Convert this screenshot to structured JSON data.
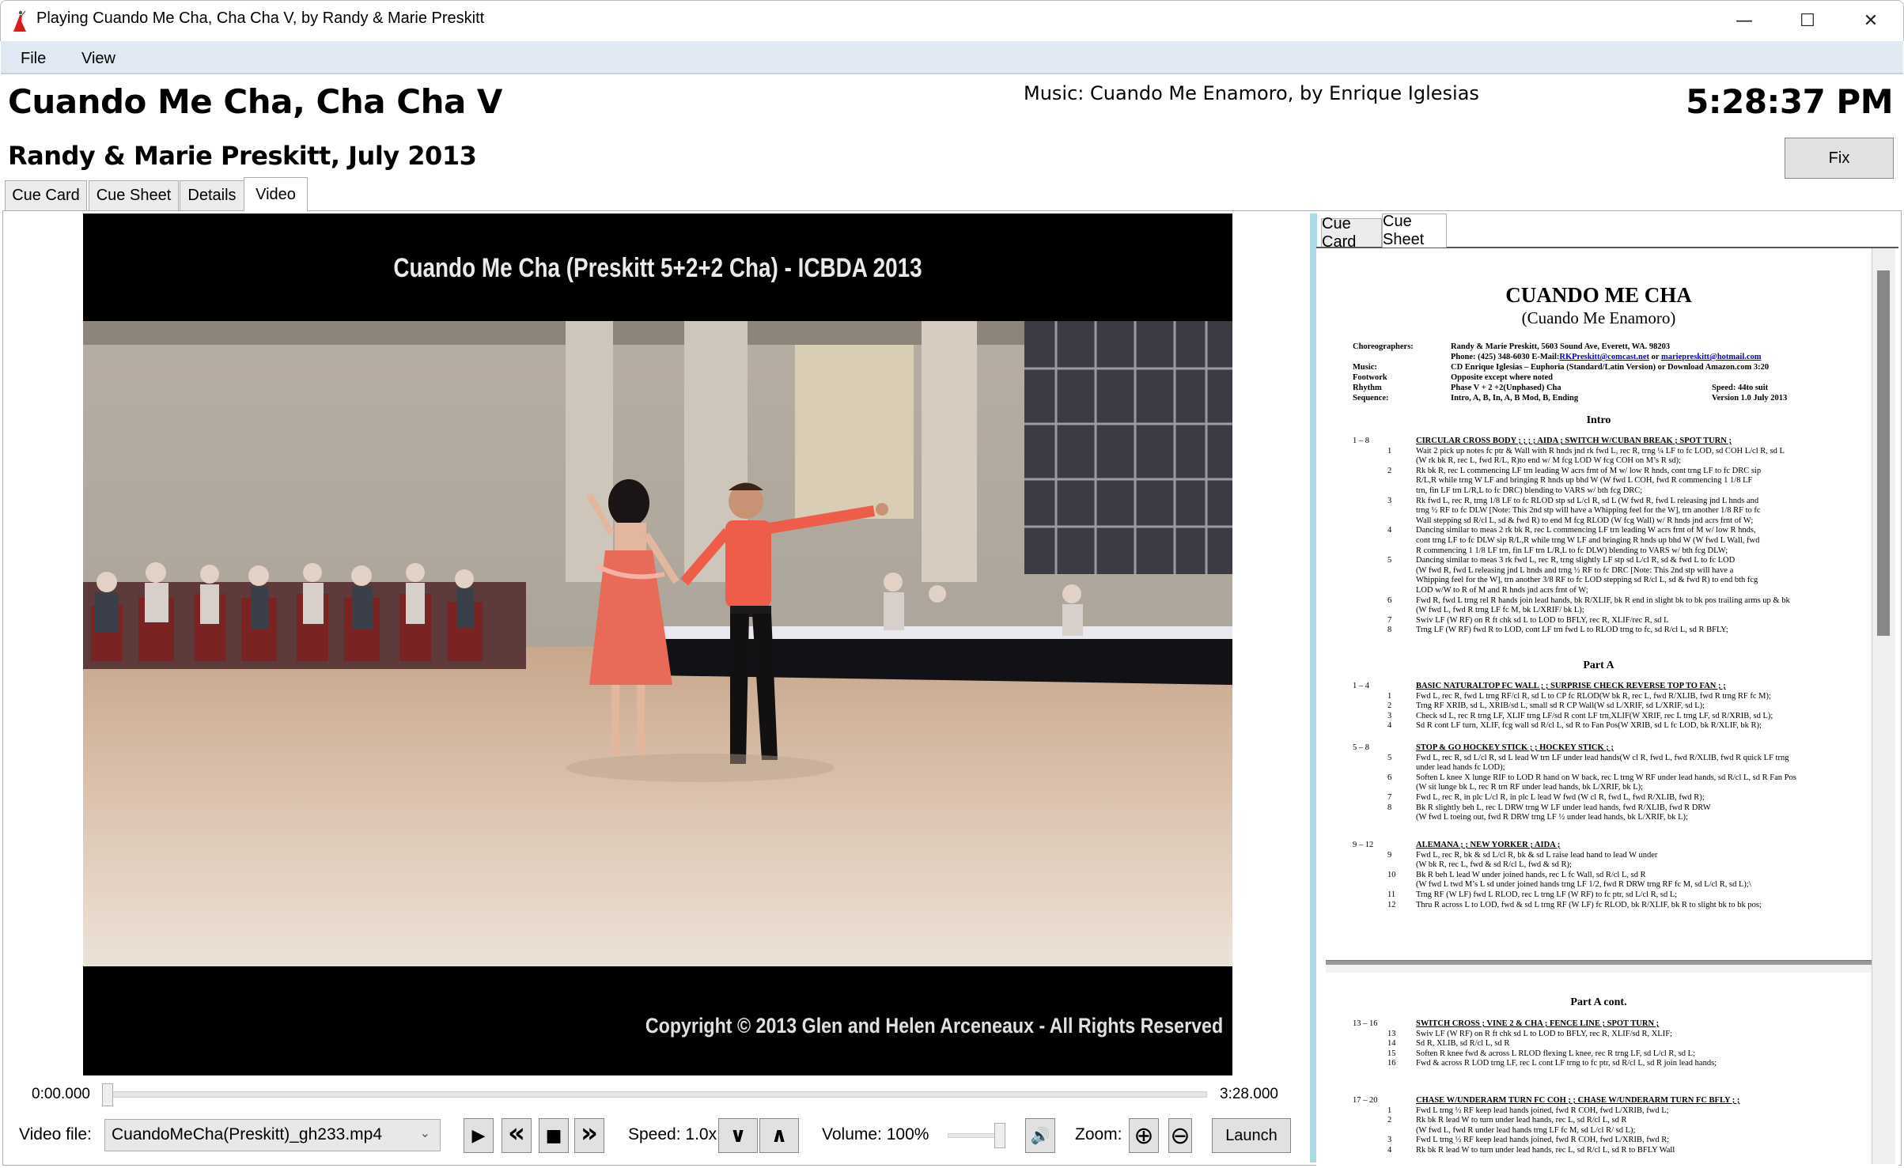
{
  "window": {
    "title": "Playing Cuando Me Cha, Cha Cha V, by Randy & Marie Preskitt",
    "minimize_glyph": "—",
    "maximize_glyph": "☐",
    "close_glyph": "✕"
  },
  "menu": {
    "items": [
      {
        "label": "File"
      },
      {
        "label": "View"
      }
    ]
  },
  "header": {
    "title": "Cuando Me Cha, Cha Cha V",
    "subtitle": "Randy & Marie Preskitt, July 2013",
    "music": "Music: Cuando Me Enamoro, by Enrique Iglesias",
    "clock": "5:28:37 PM",
    "fix_label": "Fix"
  },
  "main_tabs": [
    {
      "label": "Cue Card",
      "active": false
    },
    {
      "label": "Cue Sheet",
      "active": false
    },
    {
      "label": "Details",
      "active": false
    },
    {
      "label": "Video",
      "active": true
    }
  ],
  "video": {
    "caption_top": "Cuando Me Cha (Preskitt 5+2+2 Cha) - ICBDA 2013",
    "caption_bottom": "Copyright © 2013 Glen and Helen Arceneaux - All Rights Reserved",
    "time_current": "0:00.000",
    "time_total": "3:28.000",
    "progress_fraction": 0.0
  },
  "controls": {
    "video_file_label": "Video file:",
    "video_file_value": "CuandoMeCha(Preskitt)_gh233.mp4",
    "play_glyph": "▶",
    "rewind_glyph": "«",
    "stop_glyph": "■",
    "forward_glyph": "»",
    "speed_label": "Speed: 1.0x",
    "speed_down_glyph": "∨",
    "speed_up_glyph": "∧",
    "volume_label": "Volume: 100%",
    "volume_fraction": 1.0,
    "mute_glyph": "🔊",
    "zoom_label": "Zoom:",
    "zoom_in_glyph": "⊕",
    "zoom_out_glyph": "⊖",
    "launch_label": "Launch"
  },
  "right_tabs": [
    {
      "label": "Cue Card",
      "active": false
    },
    {
      "label": "Cue Sheet",
      "active": true
    }
  ],
  "cue_sheet": {
    "title": "CUANDO ME CHA",
    "subtitle": "(Cuando Me Enamoro)",
    "info": {
      "choreographers_key": "Choreographers:",
      "choreographers_val": "Randy & Marie Preskitt, 5603 Sound Ave, Everett, WA.  98203",
      "phone": "Phone:   (425) 348-6030   E-Mail: ",
      "email1": "RKPreskitt@comcast.net",
      "or": " or ",
      "email2": "mariepreskitt@hotmail.com",
      "music_key": "Music:",
      "music_val": "CD Enrique Iglesias – Euphoria (Standard/Latin Version) or Download Amazon.com 3:20",
      "footwork_key": "Footwork",
      "footwork_val": "Opposite except where noted",
      "rhythm_key": "Rhythm",
      "rhythm_val": "Phase V + 2 +2(Unphased) Cha",
      "speed_val": "Speed: 44to suit",
      "sequence_key": "Sequence:",
      "sequence_val": "Intro, A, B, In, A, B Mod, B, Ending",
      "version_val": "Version 1.0  July 2013"
    },
    "sections": [
      {
        "heading": "Intro"
      },
      {
        "heading": "Part A"
      },
      {
        "heading": "Part A cont."
      }
    ],
    "groups": [
      {
        "range": "1 – 8",
        "title": "CIRCULAR CROSS BODY ; ; ; ; AIDA ; SWITCH W/CUBAN BREAK ; SPOT TURN ;",
        "measures": [
          {
            "n": "1",
            "lines": [
              "Wait 2 pick up notes fc ptr & Wall with R hnds jnd rk fwd L, rec R, trng ¼ LF to fc LOD, sd COH L/cl R, sd L",
              "(W rk bk R, rec L, fwd R/L, R)to end w/ M fcg LOD W fcg COH on M’s R sd);"
            ]
          },
          {
            "n": "2",
            "lines": [
              "Rk bk R, rec L commencing LF trn leading W acrs frnt of M w/ low R hnds, cont trng LF to fc DRC sip",
              "R/L,R while trng W LF and bringing R hnds up bhd W (W fwd L COH, fwd R commencing 1 1/8 LF",
              "trn, fin LF trn L/R,L to fc DRC) blending to VARS w/ bth fcg DRC;"
            ]
          },
          {
            "n": "3",
            "lines": [
              "Rk fwd L, rec R, trng 1/8 LF to fc RLOD stp sd L/cl R, sd L (W fwd R, fwd L releasing jnd L hnds and",
              "trng ½ RF to fc DLW [Note: This 2nd stp will have a Whipping feel for the W], trn another 1/8 RF to fc",
              "Wall stepping sd R/cl L, sd & fwd R) to end M fcg RLOD (W fcg Wall) w/ R hnds jnd acrs frnt of W;"
            ]
          },
          {
            "n": "4",
            "lines": [
              "Dancing similar to meas 2 rk bk R, rec L commencing LF trn leading W acrs frnt of M w/ low R hnds,",
              "cont trng LF to fc DLW sip R/L,R while trng W LF and bringing R hnds up bhd W (W fwd L Wall, fwd",
              "R commencing 1 1/8 LF trn, fin LF trn L/R,L to fc DLW) blending to VARS w/ bth fcg DLW;"
            ]
          },
          {
            "n": "5",
            "lines": [
              "Dancing similar to meas 3 rk fwd L, rec R, trng slightly LF stp sd L/cl R, sd & fwd L to fc LOD",
              "(W fwd R, fwd L releasing jnd L hnds and trng ½ RF to fc DRC [Note: This 2nd stp will have a",
              "Whipping feel for the W], trn another 3/8 RF to fc LOD stepping sd R/cl L, sd & fwd R) to end bth fcg",
              "LOD w/W to R of M and R hnds jnd acrs frnt of W;"
            ]
          },
          {
            "n": "6",
            "lines": [
              "Fwd R, fwd L trng rel R hands join lead hands, bk R/XLIF, bk R end in slight bk to bk pos trailing arms up & bk",
              "(W fwd L, fwd R trng LF fc M, bk L/XRIF/ bk L);"
            ]
          },
          {
            "n": "7",
            "lines": [
              "Swiv LF (W RF) on R ft chk sd L to LOD to BFLY, rec R, XLIF/rec R, sd L"
            ]
          },
          {
            "n": "8",
            "lines": [
              "Trng LF (W RF) fwd R to LOD, cont LF trn fwd L to RLOD trng to fc, sd R/cl L, sd R BFLY;"
            ]
          }
        ]
      },
      {
        "range": "1 – 4",
        "title": "BASIC NATURALTOP FC WALL ; ; SURPRISE CHECK REVERSE TOP TO FAN ; ;",
        "measures": [
          {
            "n": "1",
            "lines": [
              "Fwd L, rec R, fwd L trng RF/cl R, sd L to CP fc RLOD(W bk R, rec L, fwd R/XLIB, fwd R trng RF fc M);"
            ]
          },
          {
            "n": "2",
            "lines": [
              "Trng RF XRIB, sd L, XRIB/sd L, small sd R CP Wall(W sd L/XRIF, sd L/XRIF, sd L);"
            ]
          },
          {
            "n": "3",
            "lines": [
              "Check sd L, rec R trng LF, XLIF trng LF/sd R cont LF trn,XLIF(W XRIF, rec L trng LF, sd R/XRIB, sd L);"
            ]
          },
          {
            "n": "4",
            "lines": [
              "Sd R cont LF turn, XLIF, fcg wall sd R/cl L, sd R to Fan Pos(W XRIB, sd L fc LOD, bk R/XLIF, bk R);"
            ]
          }
        ]
      },
      {
        "range": "5 – 8",
        "title": "STOP & GO HOCKEY STICK ; ; HOCKEY STICK ; ;",
        "measures": [
          {
            "n": "5",
            "lines": [
              "Fwd L, rec R, sd L/cl R, sd L lead W trn LF under lead hands(W cl R, fwd L, fwd R/XLIB, fwd R quick LF trng",
              "under lead hands fc LOD);"
            ]
          },
          {
            "n": "6",
            "lines": [
              "Soften L knee X lunge RIF to LOD R hand on W back, rec L trng W RF under lead hands, sd R/cl L, sd R Fan Pos",
              "(W sit lunge bk L, rec R trn RF under lead hands, bk L/XRIF, bk L);"
            ]
          },
          {
            "n": "7",
            "lines": [
              "Fwd L, rec R, in plc L/cl R, in plc L lead W fwd (W cl R, fwd L, fwd R/XLIB, fwd R);"
            ]
          },
          {
            "n": "8",
            "lines": [
              "Bk R slightly beh L, rec L DRW trng W LF under lead hands, fwd R/XLIB, fwd R DRW",
              "(W fwd L toeing out, fwd R DRW trng LF ½ under lead hands, bk L/XRIF, bk L);"
            ]
          }
        ]
      },
      {
        "range": "9 – 12",
        "title": "ALEMANA ; ; NEW YORKER ; AIDA ;",
        "measures": [
          {
            "n": "9",
            "lines": [
              "Fwd L, rec R, bk & sd L/cl R, bk & sd L raise lead hand to lead W under",
              "(W bk R, rec L, fwd & sd R/cl L, fwd & sd R);"
            ]
          },
          {
            "n": "10",
            "lines": [
              "Bk R beh L lead W under joined hands, rec L fc Wall, sd R/cl L, sd R",
              "(W fwd L twd M’s L sd under joined hands trng LF 1/2, fwd R DRW trng RF fc M, sd L/cl R, sd L);\\"
            ]
          },
          {
            "n": "11",
            "lines": [
              "Trng RF (W LF) fwd L RLOD, rec L trng LF (W RF) to fc ptr, sd L/cl R, sd L;"
            ]
          },
          {
            "n": "12",
            "lines": [
              "Thru R across L to LOD, fwd & sd L trng RF (W LF) fc RLOD, bk R/XLIF, bk R to slight bk to bk pos;"
            ]
          }
        ]
      },
      {
        "range": "13 – 16",
        "title": "SWITCH CROSS ; VINE 2 & CHA ; FENCE LINE ; SPOT TURN ;",
        "measures": [
          {
            "n": "13",
            "lines": [
              "Swiv LF (W RF) on R ft chk sd L to LOD to BFLY, rec R, XLIF/sd R, XLIF;"
            ]
          },
          {
            "n": "14",
            "lines": [
              "Sd R, XLIB, sd R/cl L, sd R"
            ]
          },
          {
            "n": "15",
            "lines": [
              "Soften R knee fwd & across L RLOD flexing L knee, rec R trng LF, sd L/cl R, sd L;"
            ]
          },
          {
            "n": "16",
            "lines": [
              "Fwd & across R LOD trng LF, rec L cont LF trng to fc ptr, sd R/cl L, sd R join lead hands;"
            ]
          }
        ]
      },
      {
        "range": "17 – 20",
        "title": "CHASE W/UNDERARM TURN FC COH ; ; CHASE W/UNDERARM TURN FC BFLY ; ;",
        "measures": [
          {
            "n": "1",
            "lines": [
              "Fwd L trng ½ RF keep lead hands joined, fwd R COH, fwd L/XRIB, fwd L;"
            ]
          },
          {
            "n": "2",
            "lines": [
              "Rk bk R lead W to turn under lead hands, rec L, sd R/cl L, sd R",
              "(W fwd L, fwd R under lead hands trng LF fc M, sd L/cl R/ sd L);"
            ]
          },
          {
            "n": "3",
            "lines": [
              "Fwd L trng ½ RF keep lead hands joined, fwd R COH, fwd L/XRIB, fwd R;"
            ]
          },
          {
            "n": "4",
            "lines": [
              "Rk bk R lead W to turn under lead hands, rec L, sd R/cl L, sd R to BFLY Wall"
            ]
          }
        ]
      }
    ]
  },
  "colors": {
    "menu_bg": "#dfe8f3",
    "splitter": "#add8e6",
    "link": "#0000cc",
    "button_bg": "#e1e1e1"
  }
}
